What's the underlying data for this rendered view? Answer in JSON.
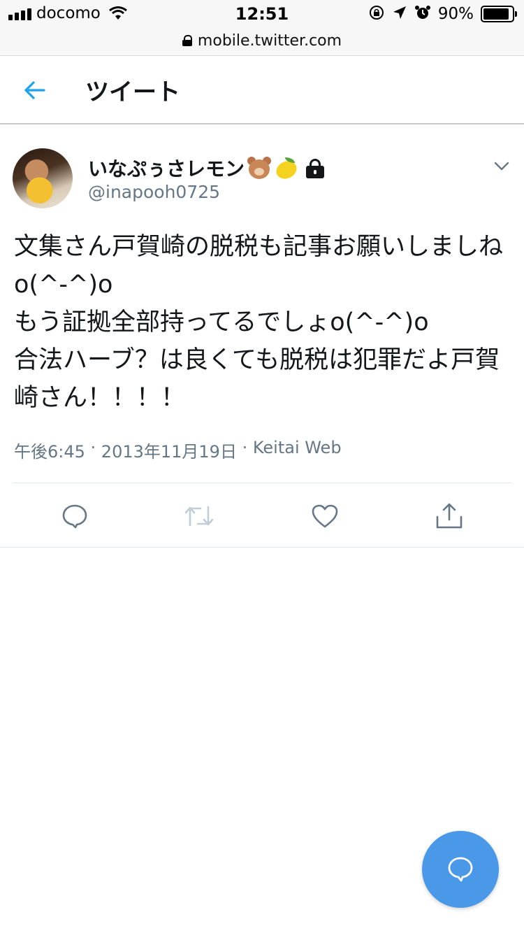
{
  "status_bar": {
    "carrier": "docomo",
    "time": "12:51",
    "battery_percent": "90%",
    "battery_level": 0.9,
    "icons": [
      "signal-icon",
      "wifi-icon",
      "orientation-lock-icon",
      "location-icon",
      "alarm-icon",
      "battery-icon"
    ]
  },
  "browser": {
    "url": "mobile.twitter.com"
  },
  "header": {
    "title": "ツイート",
    "back_icon": "arrow-left-icon"
  },
  "tweet": {
    "user_name": "いなぷぅさレモン",
    "name_emojis": [
      "bear-face-emoji",
      "lemon-emoji"
    ],
    "protected_icon": "lock-icon",
    "handle": "@inapooh0725",
    "text": "文集さん戸賀崎の脱税も記事お願いしましねo(^-^)o\nもう証拠全部持ってるでしょo(^-^)o\n合法ハーブ？は良くても脱税は犯罪だよ戸賀崎さん！！！！",
    "meta": {
      "time": "午後6:45",
      "separator": " · ",
      "date": "2013年11月19日",
      "source": "Keitai Web"
    }
  },
  "actions": [
    {
      "name": "reply",
      "icon": "reply-icon"
    },
    {
      "name": "retweet",
      "icon": "retweet-icon"
    },
    {
      "name": "like",
      "icon": "heart-icon"
    },
    {
      "name": "share",
      "icon": "share-icon"
    }
  ],
  "fab": {
    "icon": "compose-reply-icon"
  },
  "colors": {
    "accent": "#1da1f2",
    "fab": "#4a99e9",
    "secondary_text": "#657786",
    "action_icon": "#657786",
    "divider": "#e1e8ed"
  }
}
